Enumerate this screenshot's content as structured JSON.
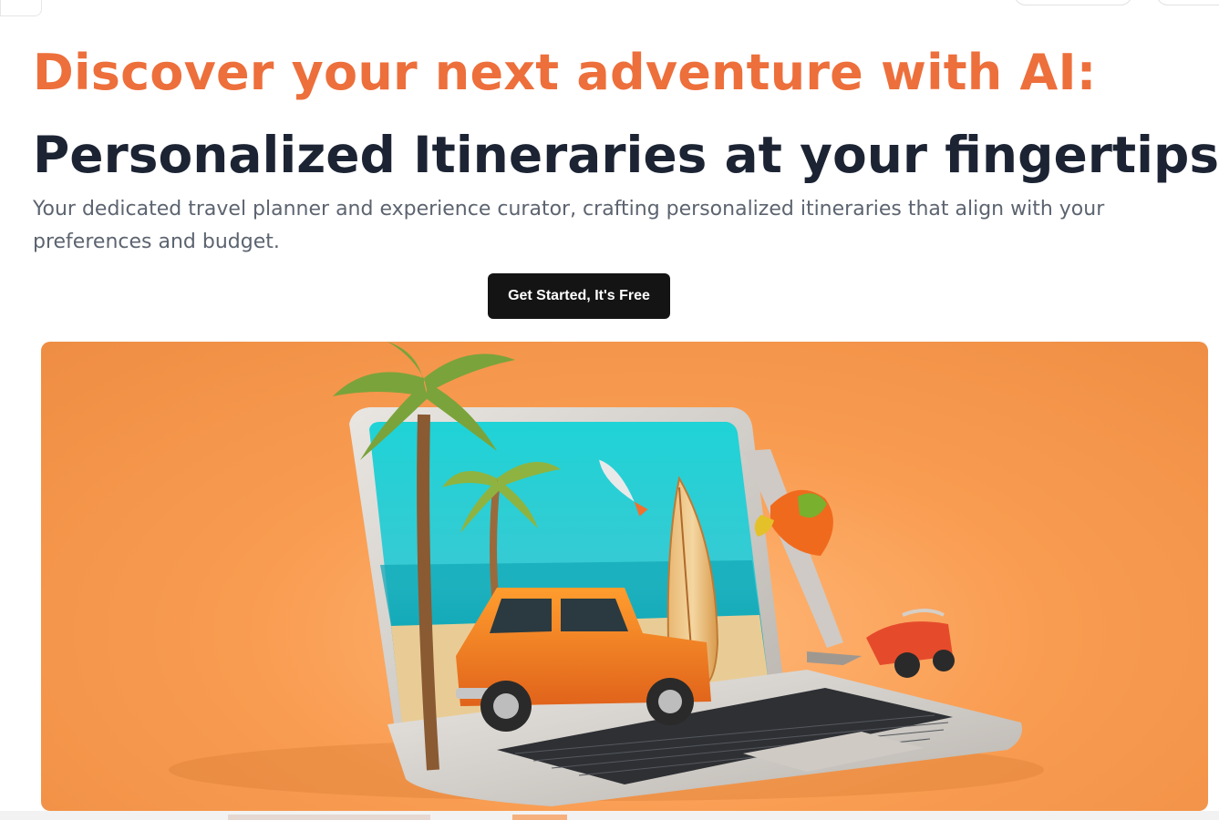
{
  "hero": {
    "headline_line1": "Discover your next adventure with AI:",
    "headline_line2": "Personalized Itineraries at your fingertips",
    "subtitle": "Your dedicated travel planner and experience curator, crafting personalized itineraries that align with your preferences and budget.",
    "cta_label": "Get Started, It's Free"
  },
  "colors": {
    "accent_orange": "#ed6f3b",
    "headline_dark": "#1c2434",
    "cta_background": "#141414",
    "hero_background": "#f99d52"
  }
}
